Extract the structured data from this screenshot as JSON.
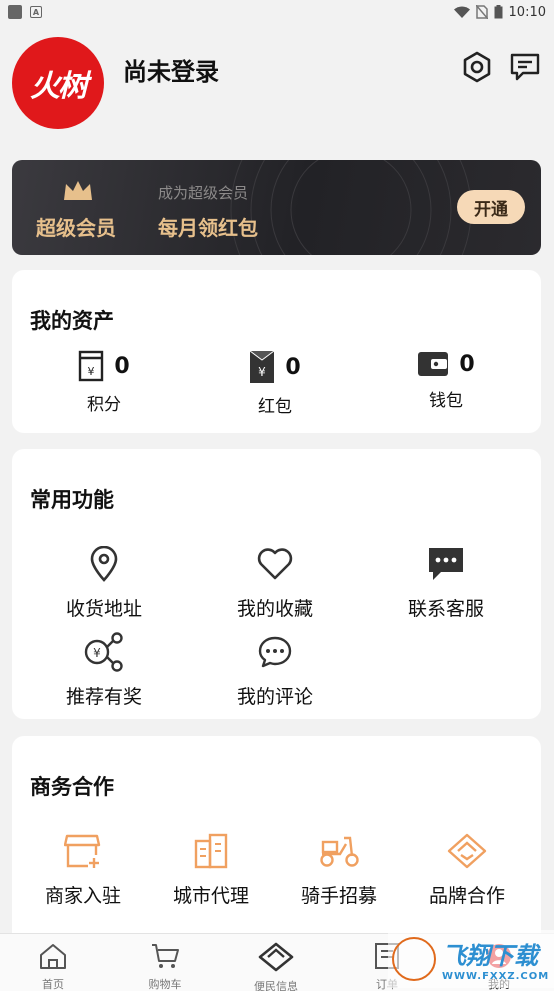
{
  "status_bar": {
    "time": "10:10"
  },
  "header": {
    "logo_text": "火树",
    "login_text": "尚未登录"
  },
  "vip": {
    "title": "超级会员",
    "subtitle": "成为超级会员",
    "main": "每月领红包",
    "button": "开通"
  },
  "assets": {
    "title": "我的资产",
    "items": [
      {
        "label": "积分",
        "value": "0",
        "icon": "points-icon"
      },
      {
        "label": "红包",
        "value": "0",
        "icon": "red-envelope-icon"
      },
      {
        "label": "钱包",
        "value": "0",
        "icon": "wallet-icon"
      }
    ]
  },
  "functions": {
    "title": "常用功能",
    "items": [
      {
        "label": "收货地址",
        "icon": "location-icon"
      },
      {
        "label": "我的收藏",
        "icon": "heart-icon"
      },
      {
        "label": "联系客服",
        "icon": "chat-icon"
      },
      {
        "label": "推荐有奖",
        "icon": "share-reward-icon"
      },
      {
        "label": "我的评论",
        "icon": "comment-icon"
      }
    ]
  },
  "business": {
    "title": "商务合作",
    "items": [
      {
        "label": "商家入驻",
        "icon": "shop-icon"
      },
      {
        "label": "城市代理",
        "icon": "city-icon"
      },
      {
        "label": "骑手招募",
        "icon": "scooter-icon"
      },
      {
        "label": "品牌合作",
        "icon": "handshake-icon"
      }
    ]
  },
  "tabbar": {
    "items": [
      {
        "label": "首页",
        "icon": "home-icon"
      },
      {
        "label": "购物车",
        "icon": "cart-icon"
      },
      {
        "label": "便民信息",
        "icon": "handshake-icon"
      },
      {
        "label": "订单",
        "icon": "order-icon"
      },
      {
        "label": "我的",
        "icon": "profile-icon"
      }
    ]
  },
  "watermark": {
    "text": "飞翔下载",
    "url": "WWW.FXXZ.COM"
  },
  "colors": {
    "brand_red": "#e0181b",
    "vip_gold": "#e7c08c",
    "vip_button": "#f6d9b7",
    "business_orange": "#f0a060"
  }
}
